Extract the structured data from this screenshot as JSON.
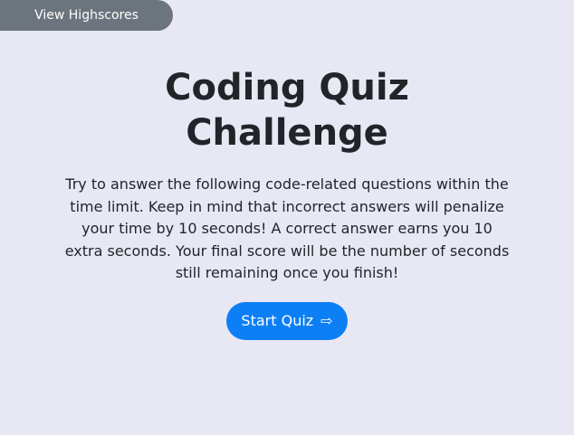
{
  "header": {
    "highscores_label": "View Highscores"
  },
  "main": {
    "title": "Coding Quiz Challenge",
    "description": "Try to answer the following code-related questions within the time limit. Keep in mind that incorrect answers will penalize your time by 10 seconds! A correct answer earns you 10 extra seconds. Your final score will be the number of seconds still remaining once you finish!",
    "start_label": "Start Quiz",
    "start_icon": "⇨"
  },
  "colors": {
    "background": "#e8e8f4",
    "highscores_button": "#6c757d",
    "start_button": "#0d7ff5",
    "text": "#212529"
  }
}
